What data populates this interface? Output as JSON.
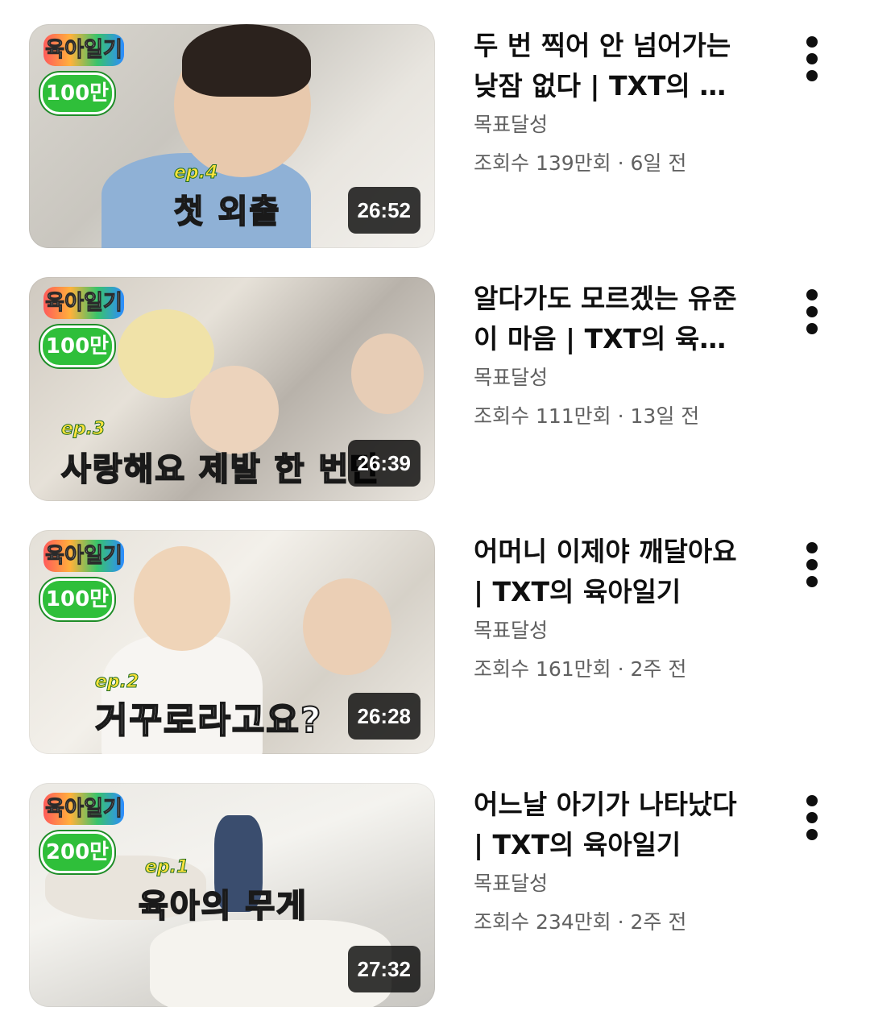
{
  "videos": [
    {
      "title": "두 번 찍어 안 넘어가는 낮잠 없다 | TXT의 육아일기",
      "channel": "목표달성",
      "stats": "조회수 139만회 · 6일 전",
      "duration": "26:52",
      "thumb_logo": "육아일기",
      "thumb_milestone": "100만",
      "thumb_episode": "ep.4",
      "thumb_overlay": "첫 외출",
      "menu_icon": "more-vert-icon"
    },
    {
      "title": "알다가도 모르겠는 유준이 마음 | TXT의 육아일기",
      "channel": "목표달성",
      "stats": "조회수 111만회 · 13일 전",
      "duration": "26:39",
      "thumb_logo": "육아일기",
      "thumb_milestone": "100만",
      "thumb_episode": "ep.3",
      "thumb_overlay": "사랑해요 제발 한 번만",
      "menu_icon": "more-vert-icon"
    },
    {
      "title": "어머니 이제야 깨달아요 | TXT의 육아일기",
      "channel": "목표달성",
      "stats": "조회수 161만회 · 2주 전",
      "duration": "26:28",
      "thumb_logo": "육아일기",
      "thumb_milestone": "100만",
      "thumb_episode": "ep.2",
      "thumb_overlay": "거꾸로라고요?",
      "menu_icon": "more-vert-icon"
    },
    {
      "title": "어느날 아기가 나타났다 | TXT의 육아일기",
      "channel": "목표달성",
      "stats": "조회수 234만회 · 2주 전",
      "duration": "27:32",
      "thumb_logo": "육아일기",
      "thumb_milestone": "200만",
      "thumb_episode": "ep.1",
      "thumb_overlay": "육아의 무게",
      "menu_icon": "more-vert-icon"
    }
  ]
}
